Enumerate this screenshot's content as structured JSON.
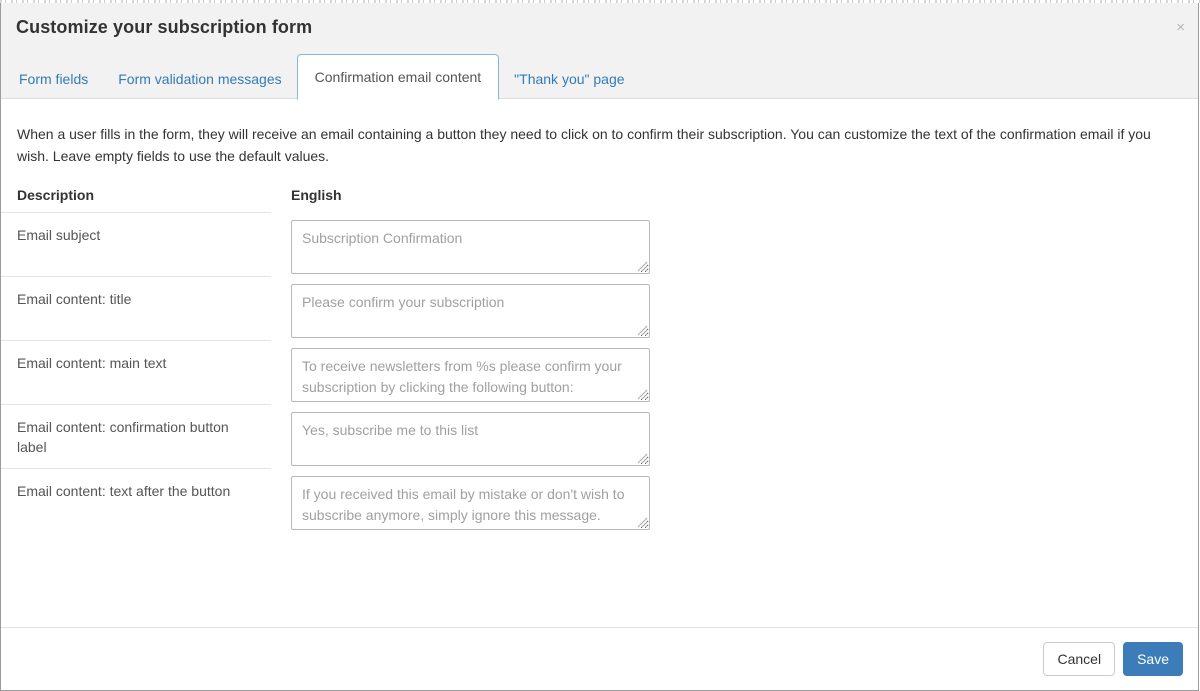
{
  "backdrop": {
    "visible": true
  },
  "dialog": {
    "title": "Customize your subscription form",
    "close_label": "×",
    "close_icon": "close-icon"
  },
  "tabs": [
    {
      "label": "Form fields",
      "active": false
    },
    {
      "label": "Form validation messages",
      "active": false
    },
    {
      "label": "Confirmation email content",
      "active": true
    },
    {
      "label": "\"Thank you\" page",
      "active": false
    }
  ],
  "body": {
    "intro": "When a user fills in the form, they will receive an email containing a button they need to click on to confirm their subscription. You can customize the text of the confirmation email if you wish. Leave empty fields to use the default values.",
    "columns": {
      "description": "Description",
      "language": "English"
    },
    "rows": [
      {
        "description": "Email subject",
        "value": "",
        "placeholder": "Subscription Confirmation"
      },
      {
        "description": "Email content: title",
        "value": "",
        "placeholder": "Please confirm your subscription"
      },
      {
        "description": "Email content: main text",
        "value": "",
        "placeholder": "To receive newsletters from %s please confirm your subscription by clicking the following button:"
      },
      {
        "description": "Email content: confirmation button label",
        "value": "",
        "placeholder": "Yes, subscribe me to this list"
      },
      {
        "description": "Email content: text after the button",
        "value": "",
        "placeholder": "If you received this email by mistake or don't wish to subscribe anymore, simply ignore this message."
      }
    ]
  },
  "footer": {
    "cancel_label": "Cancel",
    "save_label": "Save"
  },
  "colors": {
    "header_bg": "#f2f2f2",
    "link_blue": "#337ab7",
    "active_tab_border": "#85b7e0",
    "save_blue": "#3c7cb8",
    "text": "#333333",
    "muted_text": "#555555",
    "placeholder": "#a0a0a0",
    "border": "#b9b9b9",
    "row_divider": "#e4e4e4"
  }
}
